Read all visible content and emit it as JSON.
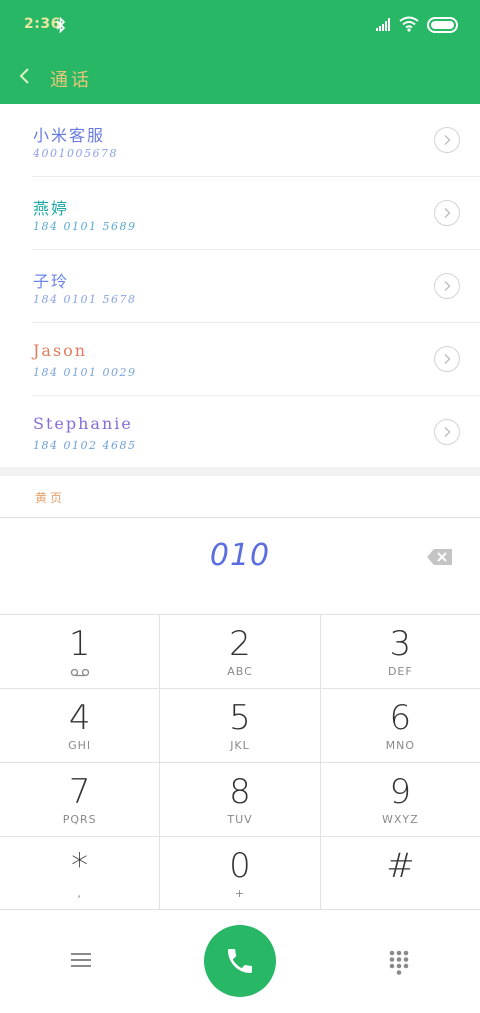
{
  "status_bar": {
    "time": "2:36"
  },
  "header": {
    "title": "通话"
  },
  "colors": {
    "brand": "#28b765",
    "key_digit": "#333333",
    "dialed": "#5b6ee0"
  },
  "contacts": [
    {
      "name": "小米客服",
      "number": "4001005678",
      "name_color": "#6a7be0",
      "number_color": "#8fa0e8"
    },
    {
      "name": "燕婷",
      "number": "184 0101 5689",
      "name_color": "#1fa8a8",
      "number_color": "#5aa9d6"
    },
    {
      "name": "子玲",
      "number": "184 0101 5678",
      "name_color": "#6b86e8",
      "number_color": "#8aa2e6"
    },
    {
      "name": "Jason",
      "number": "184 0101 0029",
      "name_color": "#e07a5a",
      "number_color": "#7aa4d8"
    },
    {
      "name": "Stephanie",
      "number": "184 0102 4685",
      "name_color": "#8b6ad8",
      "number_color": "#6fa0dc"
    }
  ],
  "yellow_pages_label": "黄页",
  "dialed_number": "010",
  "keypad": [
    [
      {
        "digit": "1",
        "letters": "",
        "icon": "voicemail-icon"
      },
      {
        "digit": "2",
        "letters": "ABC"
      },
      {
        "digit": "3",
        "letters": "DEF"
      }
    ],
    [
      {
        "digit": "4",
        "letters": "GHI"
      },
      {
        "digit": "5",
        "letters": "JKL"
      },
      {
        "digit": "6",
        "letters": "MNO"
      }
    ],
    [
      {
        "digit": "7",
        "letters": "PQRS"
      },
      {
        "digit": "8",
        "letters": "TUV"
      },
      {
        "digit": "9",
        "letters": "WXYZ"
      }
    ],
    [
      {
        "digit": "*",
        "letters": ","
      },
      {
        "digit": "0",
        "letters": "+"
      },
      {
        "digit": "#",
        "letters": ""
      }
    ]
  ],
  "bottom_bar": {
    "icons": [
      "menu-icon",
      "phone-icon",
      "dialpad-icon"
    ]
  }
}
